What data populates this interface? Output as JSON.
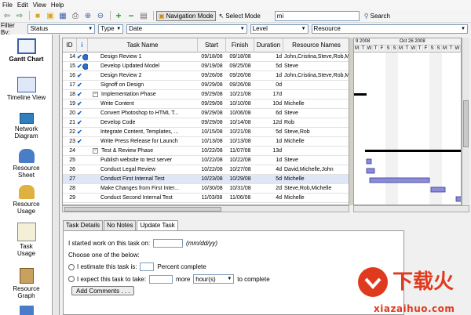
{
  "menu": [
    "File",
    "Edit",
    "View",
    "Help"
  ],
  "toolbar": {
    "nav_mode_label": "Navigation Mode",
    "select_mode_label": "Select Mode",
    "search_value": "mi",
    "search_label": "Search"
  },
  "filter": {
    "label": "Filter By:",
    "selects": [
      "Status",
      "Type",
      "Date",
      "Level",
      "Resource"
    ]
  },
  "sidebar": {
    "items": [
      {
        "label": "Gantt Chart",
        "icon": "gantt-chart-icon"
      },
      {
        "label": "Timeline View",
        "icon": "timeline-view-icon"
      },
      {
        "label": "Network Diagram",
        "icon": "network-diagram-icon"
      },
      {
        "label": "Resource Sheet",
        "icon": "resource-sheet-icon"
      },
      {
        "label": "Resource Usage",
        "icon": "resource-usage-icon"
      },
      {
        "label": "Task Usage",
        "icon": "task-usage-icon"
      },
      {
        "label": "Resource Graph",
        "icon": "resource-graph-icon"
      }
    ]
  },
  "grid": {
    "columns": [
      "ID",
      "",
      "Task Name",
      "Start",
      "Finish",
      "Duration",
      "Resource Names"
    ],
    "rows": [
      {
        "id": "14",
        "status": "check-circle",
        "name": "Design Review 1",
        "start": "09/18/08",
        "finish": "09/18/08",
        "duration": "1d",
        "resources": "John,Cristina,Steve,Rob,M",
        "indent": 1
      },
      {
        "id": "15",
        "status": "check-circle",
        "name": "Develop Updated Model",
        "start": "09/19/08",
        "finish": "09/25/08",
        "duration": "5d",
        "resources": "Steve",
        "indent": 1
      },
      {
        "id": "16",
        "status": "check",
        "name": "Design Review 2",
        "start": "09/26/08",
        "finish": "09/26/08",
        "duration": "1d",
        "resources": "John,Cristina,Steve,Rob,M",
        "indent": 1
      },
      {
        "id": "17",
        "status": "check",
        "name": "Signoff on Design",
        "start": "09/29/08",
        "finish": "09/26/08",
        "duration": "0d",
        "resources": "",
        "indent": 1
      },
      {
        "id": "18",
        "status": "check",
        "name": "Implementation Phase",
        "start": "09/29/08",
        "finish": "10/21/08",
        "duration": "17d",
        "resources": "",
        "indent": 0,
        "summary": true
      },
      {
        "id": "19",
        "status": "check",
        "name": "Write Content",
        "start": "09/29/08",
        "finish": "10/10/08",
        "duration": "10d",
        "resources": "Michelle",
        "indent": 1
      },
      {
        "id": "20",
        "status": "check",
        "name": "Convert Photoshop to HTML T...",
        "start": "09/29/08",
        "finish": "10/06/08",
        "duration": "6d",
        "resources": "Steve",
        "indent": 1
      },
      {
        "id": "21",
        "status": "check",
        "name": "Develop Code",
        "start": "09/29/08",
        "finish": "10/14/08",
        "duration": "12d",
        "resources": "Rob",
        "indent": 1
      },
      {
        "id": "22",
        "status": "check",
        "name": "Integrate Content, Templates, ...",
        "start": "10/15/08",
        "finish": "10/21/08",
        "duration": "5d",
        "resources": "Steve,Rob",
        "indent": 1
      },
      {
        "id": "23",
        "status": "check",
        "name": "Write Press Release for Launch",
        "start": "10/13/08",
        "finish": "10/13/08",
        "duration": "1d",
        "resources": "Michelle",
        "indent": 1
      },
      {
        "id": "24",
        "status": "",
        "name": "Test & Review Phase",
        "start": "10/22/08",
        "finish": "11/07/08",
        "duration": "13d",
        "resources": "",
        "indent": 0,
        "summary": true
      },
      {
        "id": "25",
        "status": "",
        "name": "Publish website to test server",
        "start": "10/22/08",
        "finish": "10/22/08",
        "duration": "1d",
        "resources": "Steve",
        "indent": 1
      },
      {
        "id": "26",
        "status": "",
        "name": "Conduct Legal Review",
        "start": "10/22/08",
        "finish": "10/27/08",
        "duration": "4d",
        "resources": "David,Michelle,John",
        "indent": 1
      },
      {
        "id": "27",
        "status": "",
        "name": "Conduct First Internal Test",
        "start": "10/23/08",
        "finish": "10/29/08",
        "duration": "5d",
        "resources": "Michelle",
        "indent": 1,
        "selected": true
      },
      {
        "id": "28",
        "status": "",
        "name": "Make Changes from First Inter...",
        "start": "10/30/08",
        "finish": "10/31/08",
        "duration": "2d",
        "resources": "Steve,Rob,Michelle",
        "indent": 1
      },
      {
        "id": "29",
        "status": "",
        "name": "Conduct Second Internal Test",
        "start": "11/03/08",
        "finish": "11/06/08",
        "duration": "4d",
        "resources": "Michelle",
        "indent": 1
      }
    ]
  },
  "gantt": {
    "months": [
      "9 2008",
      "Oct 26 2008"
    ],
    "days": [
      "M",
      "T",
      "W",
      "T",
      "F",
      "S",
      "S",
      "M",
      "T",
      "W",
      "T",
      "F",
      "S",
      "S",
      "M",
      "T",
      "W"
    ]
  },
  "detail": {
    "tabs": [
      "Task Details",
      "No Notes",
      "Update Task"
    ],
    "active_tab": "Update Task",
    "started_label": "I started work on this task on:",
    "date_hint": "(mm/dd/yy)",
    "choose_label": "Choose one of the below:",
    "estimate_label": "I estimate this task is:",
    "percent_label": "Percent complete",
    "expect_label": "I expect this task to take:",
    "more_label": "more",
    "unit_value": "hour(s)",
    "complete_label": "to complete",
    "add_comments_label": "Add Comments . . ."
  },
  "logo": {
    "text": "xiazaihuo.com",
    "brand": "下载火"
  },
  "colors": {
    "bar": "#8b8bd8",
    "check": "#1560bd",
    "logo": "#e03a1e"
  }
}
